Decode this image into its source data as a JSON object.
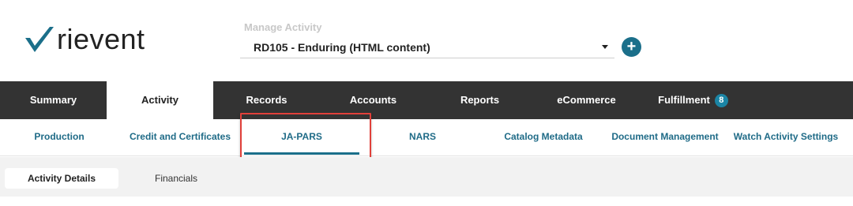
{
  "brand": {
    "name": "rievent",
    "check_color": "#1b6f8a"
  },
  "activity_picker": {
    "label": "Manage Activity",
    "selected": "RD105 - Enduring (HTML content)",
    "add_icon": "plus-icon",
    "add_glyph": "+"
  },
  "main_tabs": {
    "summary": "Summary",
    "activity": "Activity",
    "records": "Records",
    "accounts": "Accounts",
    "reports": "Reports",
    "ecommerce": "eCommerce",
    "fulfillment": "Fulfillment",
    "fulfillment_badge": "8",
    "active": "Activity"
  },
  "sub_tabs": {
    "production": "Production",
    "credit": "Credit and Certificates",
    "japars": "JA-PARS",
    "nars": "NARS",
    "catalog": "Catalog Metadata",
    "documents": "Document Management",
    "watch": "Watch Activity Settings",
    "active": "JA-PARS"
  },
  "detail_tabs": {
    "details": "Activity Details",
    "financials": "Financials",
    "active": "Activity Details"
  },
  "colors": {
    "accent": "#1b6f8a",
    "nav_bg": "#333333",
    "highlight": "#e0403a"
  }
}
